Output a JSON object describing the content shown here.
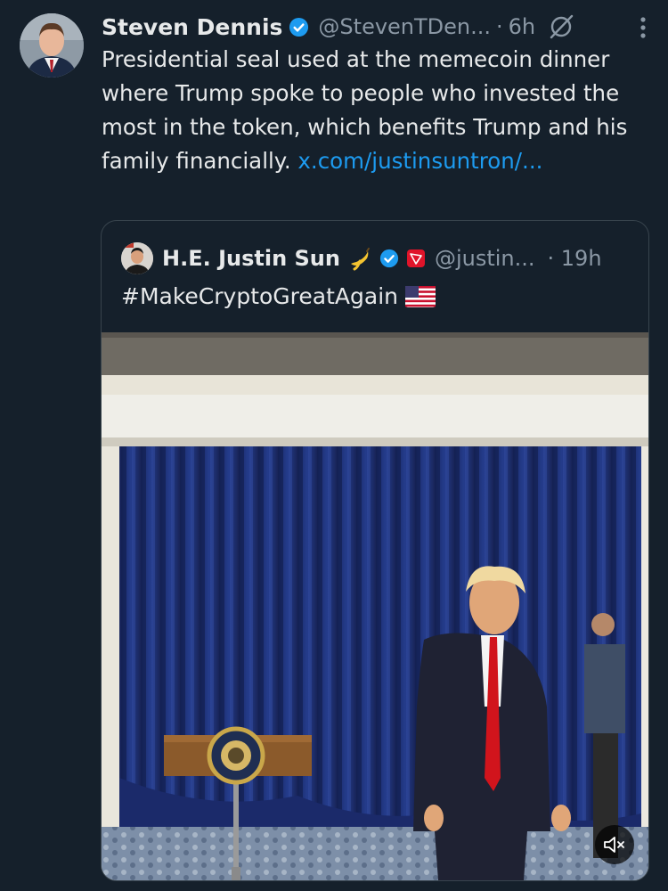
{
  "tweet": {
    "author_name": "Steven Dennis",
    "handle": "@StevenTDen...",
    "separator": "·",
    "time": "6h",
    "text": "Presidential seal used at the memecoin dinner where Trump spoke to people who invested the most in the token, which benefits Trump and his family financially. ",
    "link_text": "x.com/​justinsuntron/...",
    "icons": {
      "verified": "verified-badge-icon",
      "grok": "grok-icon",
      "more": "more-vertical-icon"
    }
  },
  "quote": {
    "author_name": "H.E. Justin Sun",
    "handle": "@justin...",
    "time": "· 19h",
    "text": "#MakeCryptoGreatAgain",
    "icons": {
      "emoji": "banana-emoji-icon",
      "verified": "verified-badge-icon",
      "tron": "tron-icon",
      "flag": "us-flag-icon",
      "mute": "mute-icon"
    }
  },
  "colors": {
    "background": "#15202b",
    "text": "#e7e9ea",
    "secondary": "#8b98a5",
    "link": "#1d9bf0",
    "border": "#38444d"
  }
}
